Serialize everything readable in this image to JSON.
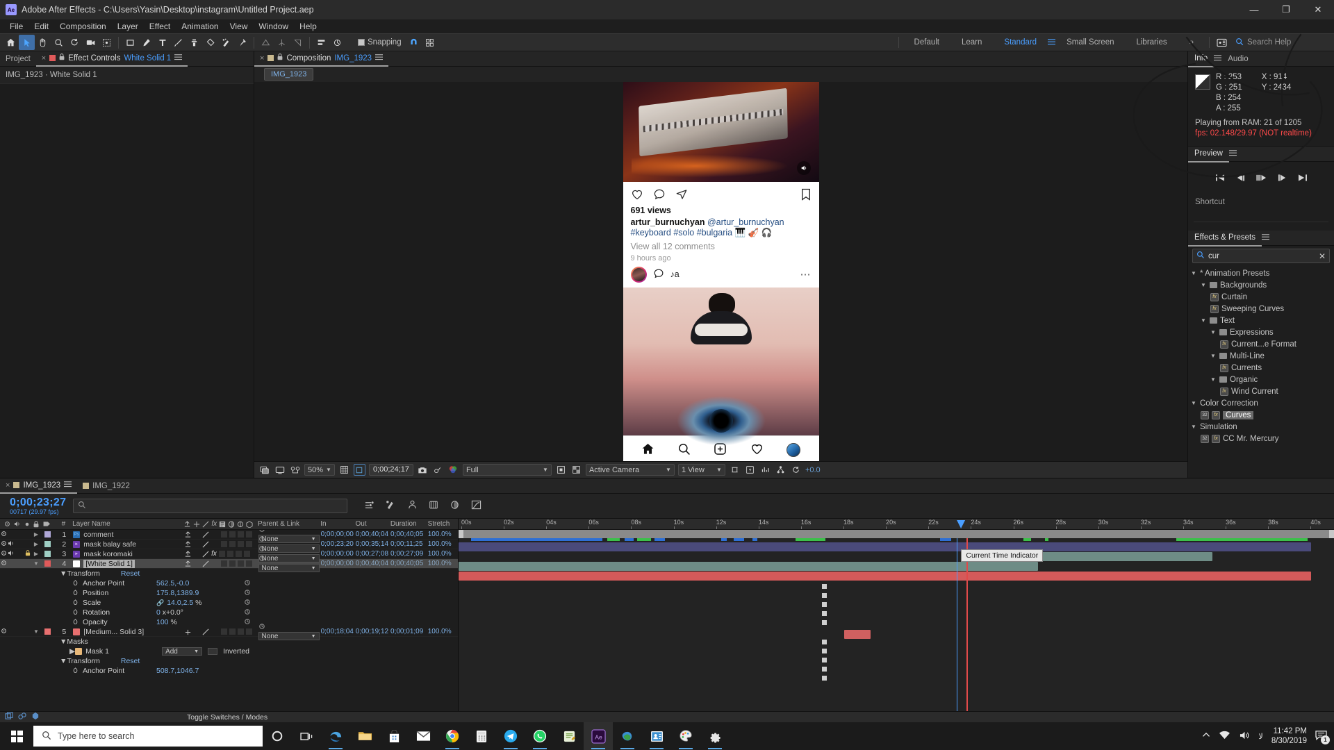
{
  "window": {
    "app_icon": "Ae",
    "title": "Adobe After Effects - C:\\Users\\Yasin\\Desktop\\instagram\\Untitled Project.aep",
    "minimize": "—",
    "maximize": "❐",
    "close": "✕"
  },
  "menubar": [
    "File",
    "Edit",
    "Composition",
    "Layer",
    "Effect",
    "Animation",
    "View",
    "Window",
    "Help"
  ],
  "toolbar": {
    "snapping_label": "Snapping",
    "workspaces": [
      "Default",
      "Learn",
      "Standard",
      "Small Screen",
      "Libraries"
    ],
    "selected_workspace": "Standard",
    "overflow": "»",
    "search_help_placeholder": "Search Help"
  },
  "left_panel": {
    "tabs": [
      "Project",
      "Effect Controls White Solid 1"
    ],
    "tab_project": "Project",
    "tab_effect_controls": "Effect Controls",
    "tab_effect_controls_target": "White Solid 1",
    "header": "IMG_1923 · White Solid 1"
  },
  "composition": {
    "tab_label": "Composition",
    "tab_target": "IMG_1923",
    "breadcrumb": "IMG_1923",
    "viewer_bar": {
      "zoom": "50%",
      "timecode": "0;00;24;17",
      "resolution": "Full",
      "camera": "Active Camera",
      "views": "1 View",
      "exposure": "+0.0"
    },
    "instagram": {
      "views": "691 views",
      "username": "artur_burnuchyan",
      "handle": "@artur_burnuchyan",
      "hashtags": "#keyboard #solo #bulgaria",
      "emojis": "🎹 🎻 🎧",
      "view_comments": "View all 12 comments",
      "timestamp": "9 hours ago",
      "comment_text": "♪а"
    }
  },
  "info_panel": {
    "tabs": [
      "Info",
      "Audio"
    ],
    "tab_info": "Info",
    "tab_audio": "Audio",
    "r": "R : 253",
    "g": "G : 251",
    "b": "B : 254",
    "a": "A : 255",
    "x": "X : 914",
    "y": "Y : 2434",
    "ram_status": "Playing from RAM: 21 of 1205",
    "fps_status": "fps: 02.148/29.97 (NOT realtime)"
  },
  "preview_panel": {
    "title": "Preview",
    "shortcut_label": "Shortcut"
  },
  "effects_panel": {
    "title": "Effects & Presets",
    "search_value": "cur",
    "clear_icon": "✕",
    "tree": [
      {
        "label": "* Animation Presets",
        "indent": 0,
        "type": "group",
        "expanded": true
      },
      {
        "label": "Backgrounds",
        "indent": 1,
        "type": "folder",
        "expanded": true
      },
      {
        "label": "Curtain",
        "indent": 2,
        "type": "preset"
      },
      {
        "label": "Sweeping Curves",
        "indent": 2,
        "type": "preset"
      },
      {
        "label": "Text",
        "indent": 1,
        "type": "folder",
        "expanded": true
      },
      {
        "label": "Expressions",
        "indent": 2,
        "type": "folder",
        "expanded": true
      },
      {
        "label": "Current...e Format",
        "indent": 3,
        "type": "preset"
      },
      {
        "label": "Multi-Line",
        "indent": 2,
        "type": "folder",
        "expanded": true
      },
      {
        "label": "Currents",
        "indent": 3,
        "type": "preset"
      },
      {
        "label": "Organic",
        "indent": 2,
        "type": "folder",
        "expanded": true
      },
      {
        "label": "Wind Current",
        "indent": 3,
        "type": "preset"
      },
      {
        "label": "Color Correction",
        "indent": 0,
        "type": "group",
        "expanded": true
      },
      {
        "label": "Curves",
        "indent": 1,
        "type": "effect32",
        "selected": true
      },
      {
        "label": "Simulation",
        "indent": 0,
        "type": "group",
        "expanded": true
      },
      {
        "label": "CC Mr. Mercury",
        "indent": 1,
        "type": "effect32"
      }
    ]
  },
  "timeline": {
    "tabs": [
      {
        "label": "IMG_1923",
        "active": true,
        "color": "#c9b98f"
      },
      {
        "label": "IMG_1922",
        "active": false,
        "color": "#c9b98f"
      }
    ],
    "current_time": "0;00;23;27",
    "frame_info": "00717 (29.97 fps)",
    "search_placeholder": "",
    "columns": [
      "#",
      "Layer Name",
      "Parent & Link",
      "In",
      "Out",
      "Duration",
      "Stretch"
    ],
    "col_num": "#",
    "col_name": "Layer Name",
    "col_parent": "Parent & Link",
    "col_in": "In",
    "col_out": "Out",
    "col_duration": "Duration",
    "col_stretch": "Stretch",
    "layers": [
      {
        "num": "1",
        "name": "comment",
        "parent": "None",
        "in": "0;00;00;00",
        "out": "0;00;40;04",
        "duration": "0;00;40;05",
        "stretch": "100.0%",
        "color": "#b0a8d8",
        "kind": "ps",
        "audio": false,
        "locked": false,
        "selected": false,
        "fx": false
      },
      {
        "num": "2",
        "name": "mask balay safe",
        "parent": "None",
        "in": "0;00;23;20",
        "out": "0;00;35;14",
        "duration": "0;00;11;25",
        "stretch": "100.0%",
        "color": "#9fcfc4",
        "kind": "video",
        "audio": true,
        "locked": false,
        "selected": false,
        "fx": false
      },
      {
        "num": "3",
        "name": "mask koromaki",
        "parent": "None",
        "in": "0;00;00;00",
        "out": "0;00;27;08",
        "duration": "0;00;27;09",
        "stretch": "100.0%",
        "color": "#9fcfc4",
        "kind": "video",
        "audio": true,
        "locked": true,
        "selected": false,
        "fx": true
      },
      {
        "num": "4",
        "name": "[White Solid 1]",
        "parent": "None",
        "in": "0;00;00;00",
        "out": "0;00;40;04",
        "duration": "0;00;40;05",
        "stretch": "100.0%",
        "color": "#e05a5a",
        "kind": "solid-white",
        "audio": false,
        "locked": false,
        "selected": true,
        "fx": false
      }
    ],
    "transform_group": {
      "label": "Transform",
      "reset": "Reset"
    },
    "properties": [
      {
        "name": "Anchor Point",
        "value": "562.5,-0.0"
      },
      {
        "name": "Position",
        "value": "175.8,1389.9"
      },
      {
        "name": "Scale",
        "value": "14.0,2.5",
        "unit": "%",
        "linked": true
      },
      {
        "name": "Rotation",
        "value": "0",
        "unit2": "x+0.0°"
      },
      {
        "name": "Opacity",
        "value": "100",
        "unit": "%"
      }
    ],
    "layer5": {
      "num": "5",
      "name": "[Medium... Solid 3]",
      "parent": "None",
      "in": "0;00;18;04",
      "out": "0;00;19;12",
      "duration": "0;00;01;09",
      "stretch": "100.0%",
      "color": "#e87070"
    },
    "masks_group": "Masks",
    "mask1": {
      "name": "Mask 1",
      "mode": "Add",
      "inverted": "Inverted"
    },
    "transform_group2": {
      "label": "Transform",
      "reset": "Reset"
    },
    "anchor2": {
      "name": "Anchor Point",
      "value": "508.7,1046.7"
    },
    "ruler_ticks": [
      "00s",
      "02s",
      "04s",
      "06s",
      "08s",
      "10s",
      "12s",
      "14s",
      "16s",
      "18s",
      "20s",
      "22s",
      "24s",
      "26s",
      "28s",
      "30s",
      "32s",
      "34s",
      "36s",
      "38s",
      "40s"
    ],
    "cti_tooltip": "Current Time Indicator",
    "footer_label": "Toggle Switches / Modes"
  },
  "taskbar": {
    "search_placeholder": "Type here to search",
    "time": "11:42 PM",
    "date": "8/30/2019",
    "notification_count": "1"
  }
}
